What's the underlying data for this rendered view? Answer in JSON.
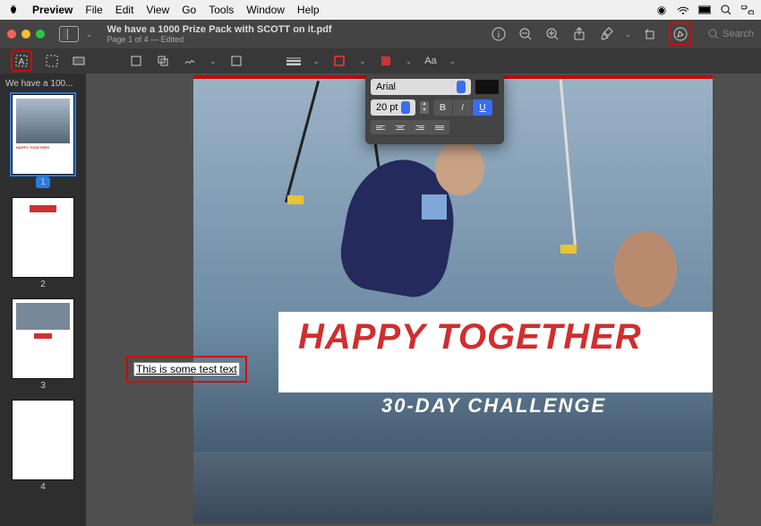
{
  "menubar": {
    "app": "Preview",
    "items": [
      "File",
      "Edit",
      "View",
      "Go",
      "Tools",
      "Window",
      "Help"
    ]
  },
  "titlebar": {
    "filename": "We have a 1000 Prize Pack with SCOTT on it.pdf",
    "subtitle": "Page 1 of 4  —  Edited"
  },
  "search": {
    "placeholder": "Search"
  },
  "sidebar": {
    "title": "We have a 100..."
  },
  "pages": {
    "p1": "1",
    "p2": "2",
    "p3": "3",
    "p4": "4"
  },
  "document": {
    "headline": "HAPPY TOGETHER",
    "subhead": "30-DAY CHALLENGE"
  },
  "annotation": {
    "text": "This is some test text"
  },
  "fontpanel": {
    "family": "Arial",
    "size": "20 pt",
    "bold": "B",
    "italic": "I",
    "underline": "U"
  }
}
